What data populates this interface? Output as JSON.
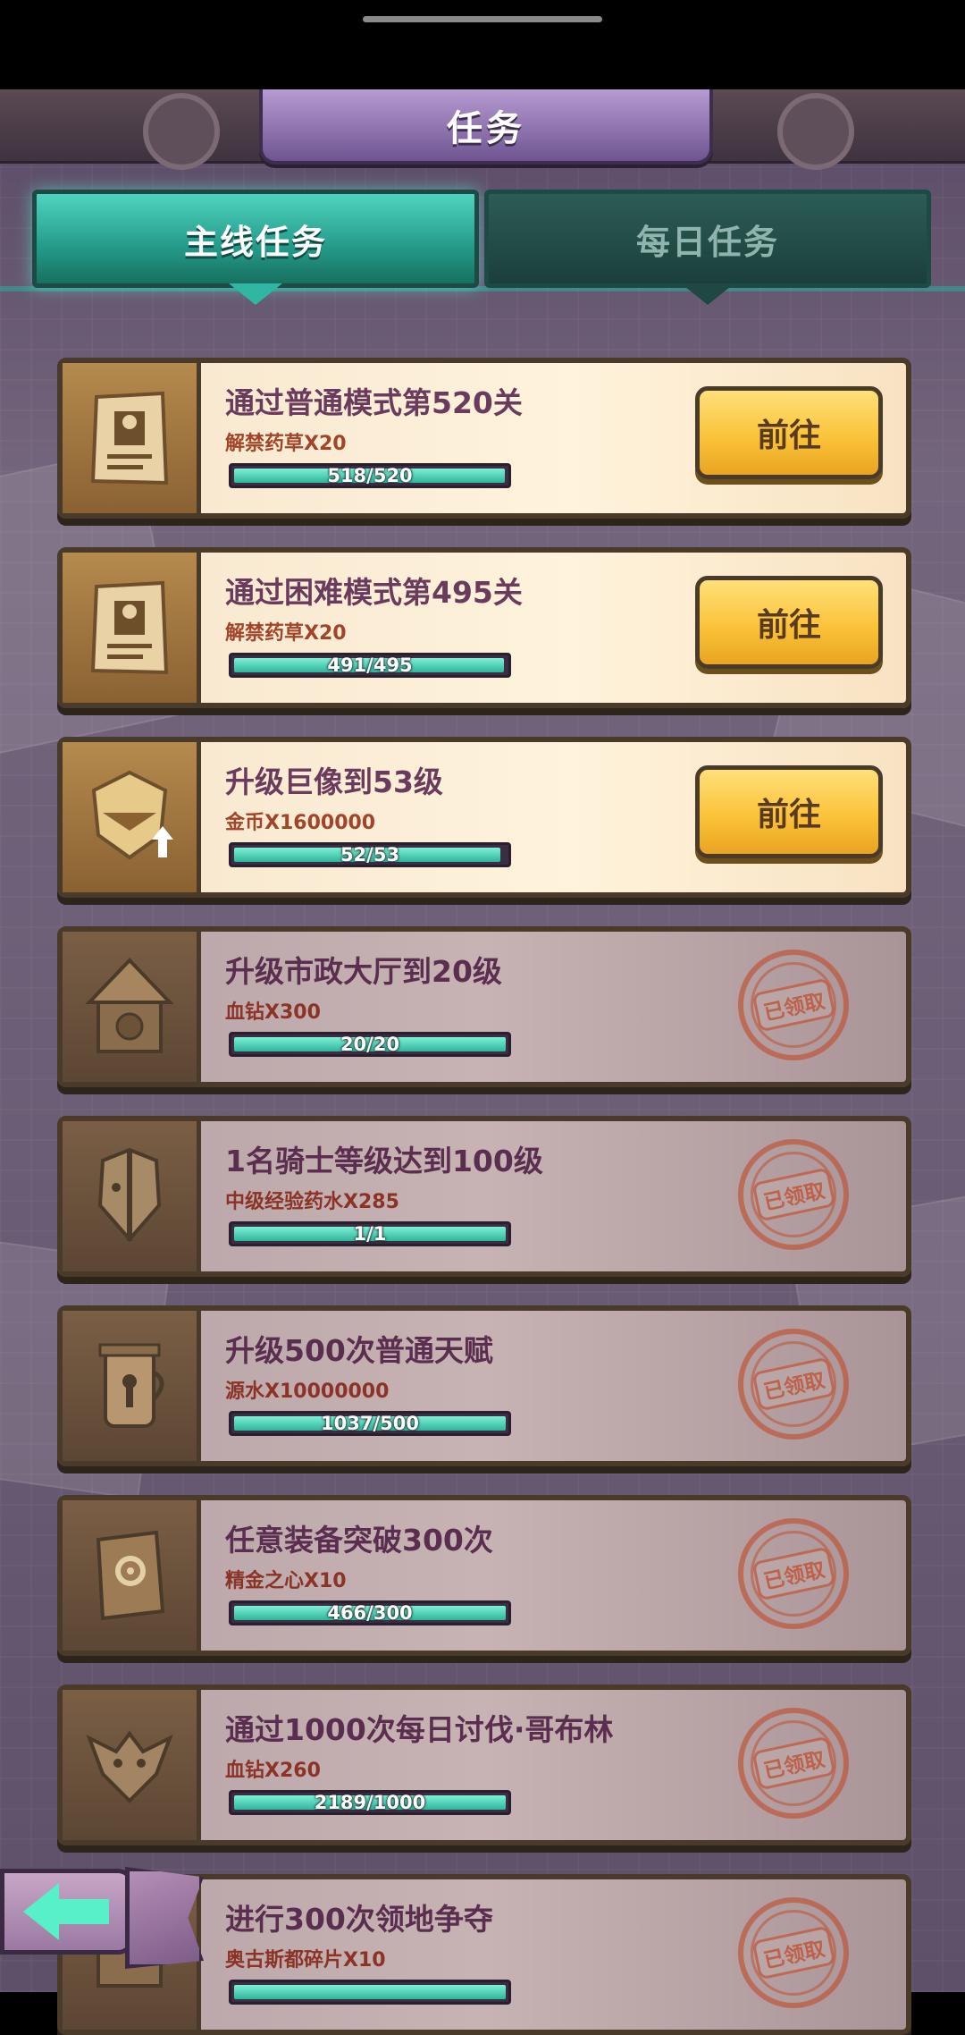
{
  "header": {
    "title": "任务"
  },
  "tabs": [
    {
      "label": "主线任务",
      "active": true
    },
    {
      "label": "每日任务",
      "active": false
    }
  ],
  "tasks": [
    {
      "title": "通过普通模式第520关",
      "reward": "解禁药草X20",
      "progress": "518/520",
      "ratio": 0.996,
      "status": "open",
      "action": "前往",
      "icon": "wanted-poster-icon"
    },
    {
      "title": "通过困难模式第495关",
      "reward": "解禁药草X20",
      "progress": "491/495",
      "ratio": 0.992,
      "status": "open",
      "action": "前往",
      "icon": "wanted-poster-icon"
    },
    {
      "title": "升级巨像到53级",
      "reward": "金币X1600000",
      "progress": "52/53",
      "ratio": 0.981,
      "status": "open",
      "action": "前往",
      "icon": "colossus-helmet-upgrade-icon"
    },
    {
      "title": "升级市政大厅到20级",
      "reward": "血钻X300",
      "progress": "20/20",
      "ratio": 1.0,
      "status": "done",
      "action": "已领取",
      "icon": "town-hall-icon"
    },
    {
      "title": "1名骑士等级达到100级",
      "reward": "中级经验药水X285",
      "progress": "1/1",
      "ratio": 1.0,
      "status": "done",
      "action": "已领取",
      "icon": "knight-portrait-icon"
    },
    {
      "title": "升级500次普通天赋",
      "reward": "源水X10000000",
      "progress": "1037/500",
      "ratio": 1.0,
      "status": "done",
      "action": "已领取",
      "icon": "potion-jar-icon"
    },
    {
      "title": "任意装备突破300次",
      "reward": "精金之心X10",
      "progress": "466/300",
      "ratio": 1.0,
      "status": "done",
      "action": "已领取",
      "icon": "gear-book-icon"
    },
    {
      "title": "通过1000次每日讨伐·哥布林",
      "reward": "血钻X260",
      "progress": "2189/1000",
      "ratio": 1.0,
      "status": "done",
      "action": "已领取",
      "icon": "goblin-icon"
    },
    {
      "title": "进行300次领地争夺",
      "reward": "奥古斯都碎片X10",
      "progress": "",
      "ratio": 1.0,
      "status": "done",
      "action": "已领取",
      "icon": "territory-icon"
    }
  ],
  "colors": {
    "accent": "#2fb59a",
    "button": "#fbc33a",
    "stamp": "#be5032",
    "title": "#6a3b5d"
  }
}
